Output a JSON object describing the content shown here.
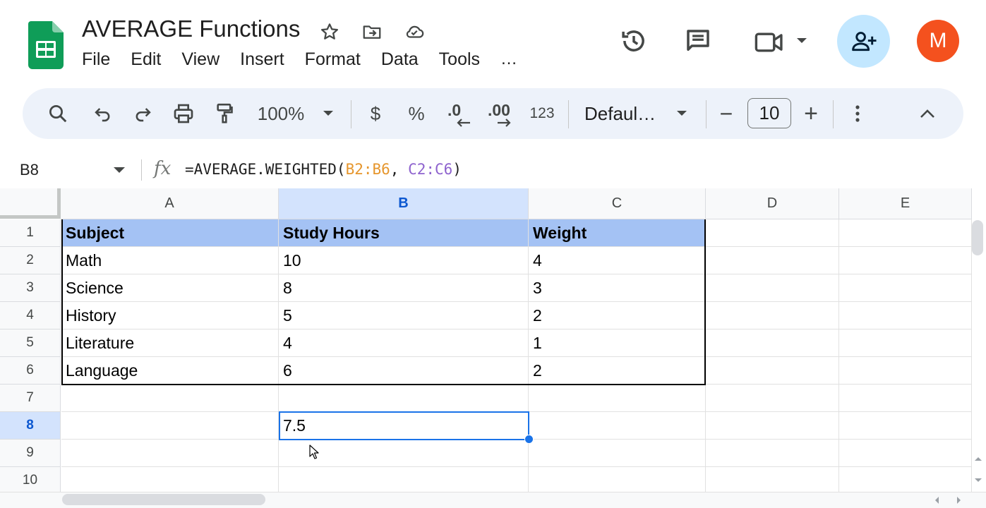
{
  "app": {
    "doc_title": "AVERAGE Functions",
    "avatar_letter": "M",
    "brand_color": "#0f9d58",
    "accent_color": "#1a73e8"
  },
  "menu": [
    "File",
    "Edit",
    "View",
    "Insert",
    "Format",
    "Data",
    "Tools",
    "…"
  ],
  "toolbar": {
    "zoom": "100%",
    "currency": "$",
    "percent": "%",
    "decrease_decimal": ".0",
    "increase_decimal": ".00",
    "number_format": "123",
    "font": "Defaul…",
    "font_size": "10",
    "minus": "−",
    "plus": "+"
  },
  "formula_bar": {
    "cell_ref": "B8",
    "fx": "fx",
    "formula_prefix": "=AVERAGE.WEIGHTED(",
    "range1": "B2:B6",
    "separator": ", ",
    "range2": "C2:C6",
    "formula_suffix": ")"
  },
  "columns": [
    "A",
    "B",
    "C",
    "D",
    "E"
  ],
  "rows": [
    "1",
    "2",
    "3",
    "4",
    "5",
    "6",
    "7",
    "8",
    "9",
    "10"
  ],
  "cells": {
    "A1": "Subject",
    "B1": "Study Hours",
    "C1": "Weight",
    "A2": "Math",
    "B2": "10",
    "C2": "4",
    "A3": "Science",
    "B3": "8",
    "C3": "3",
    "A4": "History",
    "B4": "5",
    "C4": "2",
    "A5": "Literature",
    "B5": "4",
    "C5": "1",
    "A6": "Language",
    "B6": "6",
    "C6": "2",
    "B8": "7.5"
  },
  "selection": {
    "cell": "B8",
    "column": "B",
    "row": "8"
  }
}
